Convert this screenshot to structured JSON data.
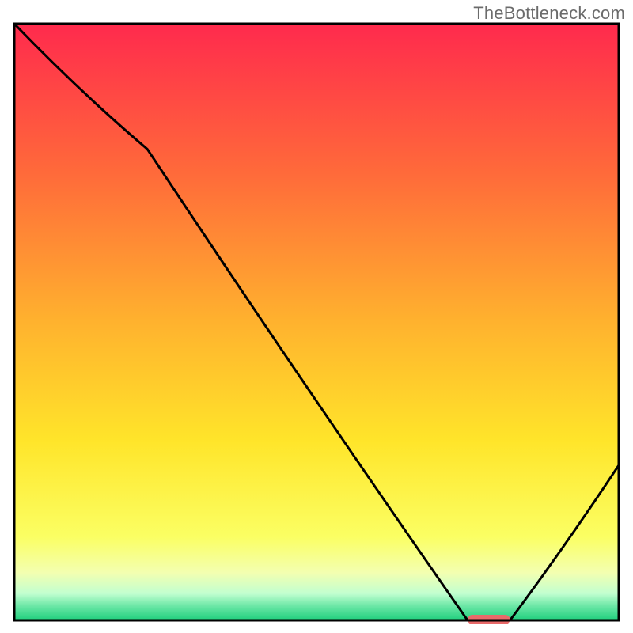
{
  "watermark": "TheBottleneck.com",
  "chart_data": {
    "type": "line",
    "title": "",
    "xlabel": "",
    "ylabel": "",
    "xlim": [
      0,
      100
    ],
    "ylim": [
      0,
      100
    ],
    "series": [
      {
        "name": "curve",
        "x": [
          0,
          22,
          75,
          82,
          100
        ],
        "y": [
          100,
          79,
          0,
          0,
          26
        ]
      }
    ],
    "marker": {
      "x_start": 75,
      "x_end": 82,
      "y": 0
    },
    "background_gradient_stops": [
      {
        "offset": 0.0,
        "color": "#ff2a4d"
      },
      {
        "offset": 0.25,
        "color": "#ff6a3a"
      },
      {
        "offset": 0.5,
        "color": "#ffb22e"
      },
      {
        "offset": 0.7,
        "color": "#ffe52a"
      },
      {
        "offset": 0.86,
        "color": "#fbff63"
      },
      {
        "offset": 0.92,
        "color": "#f3ffb0"
      },
      {
        "offset": 0.955,
        "color": "#c2ffd0"
      },
      {
        "offset": 0.975,
        "color": "#6fe8a8"
      },
      {
        "offset": 1.0,
        "color": "#1fcf7d"
      }
    ],
    "marker_color": "#e86a6a",
    "curve_color": "#000000",
    "frame_color": "#000000"
  }
}
